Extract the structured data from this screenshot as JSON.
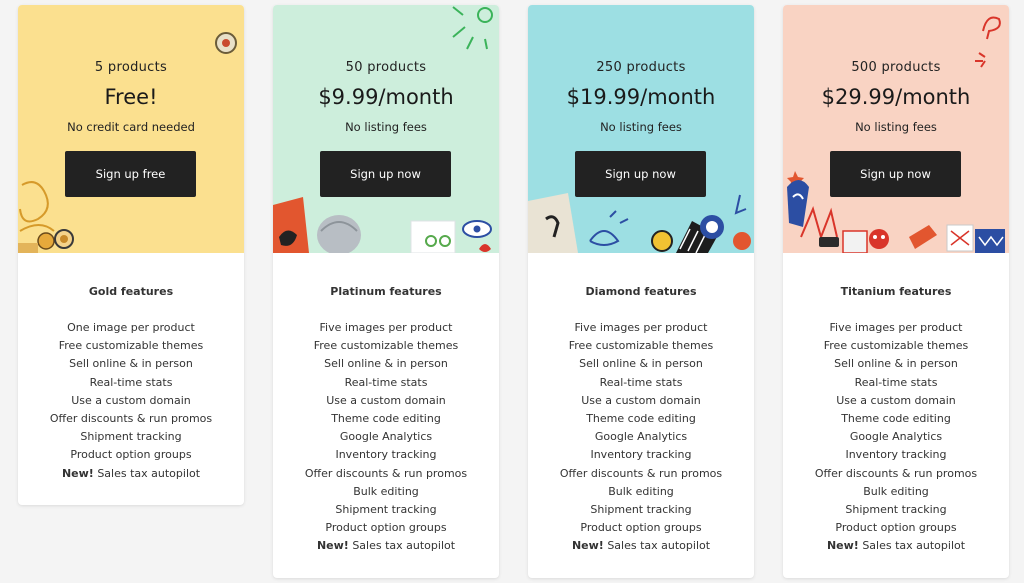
{
  "plans": [
    {
      "quantity": "5 products",
      "price": "Free!",
      "note": "No credit card needed",
      "cta": "Sign up free",
      "features_title": "Gold features",
      "features": [
        "One image per product",
        "Free customizable themes",
        "Sell online & in person",
        "Real-time stats",
        "Use a custom domain",
        "Offer discounts & run promos",
        "Shipment tracking",
        "Product option groups"
      ],
      "new_label": "New!",
      "new_feature": "Sales tax autopilot",
      "color": "#fbe08f"
    },
    {
      "quantity": "50 products",
      "price": "$9.99/month",
      "note": "No listing fees",
      "cta": "Sign up now",
      "features_title": "Platinum features",
      "features": [
        "Five images per product",
        "Free customizable themes",
        "Sell online & in person",
        "Real-time stats",
        "Use a custom domain",
        "Theme code editing",
        "Google Analytics",
        "Inventory tracking",
        "Offer discounts & run promos",
        "Bulk editing",
        "Shipment tracking",
        "Product option groups"
      ],
      "new_label": "New!",
      "new_feature": "Sales tax autopilot",
      "color": "#cdeedc"
    },
    {
      "quantity": "250 products",
      "price": "$19.99/month",
      "note": "No listing fees",
      "cta": "Sign up now",
      "features_title": "Diamond features",
      "features": [
        "Five images per product",
        "Free customizable themes",
        "Sell online & in person",
        "Real-time stats",
        "Use a custom domain",
        "Theme code editing",
        "Google Analytics",
        "Inventory tracking",
        "Offer discounts & run promos",
        "Bulk editing",
        "Shipment tracking",
        "Product option groups"
      ],
      "new_label": "New!",
      "new_feature": "Sales tax autopilot",
      "color": "#9ddfe3"
    },
    {
      "quantity": "500 products",
      "price": "$29.99/month",
      "note": "No listing fees",
      "cta": "Sign up now",
      "features_title": "Titanium features",
      "features": [
        "Five images per product",
        "Free customizable themes",
        "Sell online & in person",
        "Real-time stats",
        "Use a custom domain",
        "Theme code editing",
        "Google Analytics",
        "Inventory tracking",
        "Offer discounts & run promos",
        "Bulk editing",
        "Shipment tracking",
        "Product option groups"
      ],
      "new_label": "New!",
      "new_feature": "Sales tax autopilot",
      "color": "#f9d3c3"
    }
  ]
}
